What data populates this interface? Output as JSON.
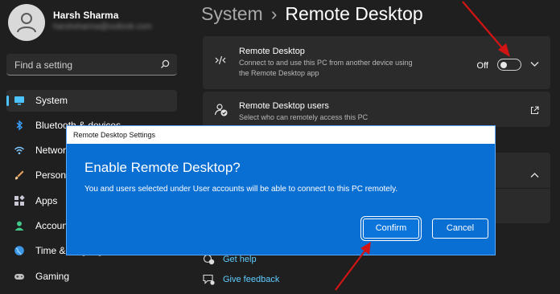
{
  "user": {
    "name": "Harsh Sharma",
    "email": "harshsharma@outlook.com"
  },
  "search": {
    "placeholder": "Find a setting",
    "icon": "search-icon"
  },
  "sidebar": {
    "items": [
      {
        "label": "System",
        "icon": "monitor-icon",
        "active": true
      },
      {
        "label": "Bluetooth & devices",
        "icon": "bluetooth-icon"
      },
      {
        "label": "Network & internet",
        "icon": "wifi-icon"
      },
      {
        "label": "Personalization",
        "icon": "brush-icon"
      },
      {
        "label": "Apps",
        "icon": "apps-icon"
      },
      {
        "label": "Accounts",
        "icon": "person-icon"
      },
      {
        "label": "Time & language",
        "icon": "globe-icon"
      },
      {
        "label": "Gaming",
        "icon": "gamepad-icon"
      }
    ]
  },
  "header": {
    "crumb": "System",
    "separator": "›",
    "title": "Remote Desktop"
  },
  "cards": {
    "remote_desktop": {
      "title": "Remote Desktop",
      "subtitle": "Connect to and use this PC from another device using the Remote Desktop app",
      "toggle_label": "Off",
      "toggle_on": false
    },
    "remote_users": {
      "title": "Remote Desktop users",
      "subtitle": "Select who can remotely access this PC"
    }
  },
  "links": {
    "help": "Get help",
    "feedback": "Give feedback"
  },
  "dialog": {
    "window_title": "Remote Desktop Settings",
    "heading": "Enable Remote Desktop?",
    "message": "You and users selected under User accounts will be able to connect to this PC remotely.",
    "confirm_label": "Confirm",
    "cancel_label": "Cancel"
  },
  "colors": {
    "background": "#1f1f1f",
    "card": "#2b2b2b",
    "accent": "#4cc2ff",
    "dialog_blue": "#0a6fd3",
    "link": "#60cdff",
    "annotation_arrow": "#d21414"
  }
}
